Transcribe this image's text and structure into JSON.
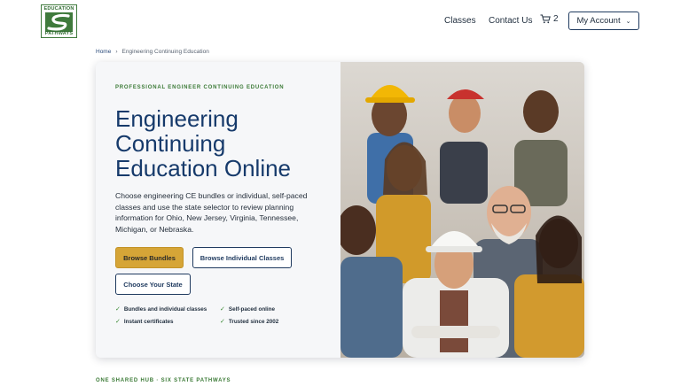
{
  "brand": {
    "logo_top": "EDUCATION",
    "logo_bottom": "PATHWAYS",
    "logo_color": "#3f7a3c"
  },
  "nav": {
    "classes": "Classes",
    "contact": "Contact Us",
    "cart_count": "2",
    "account": "My Account"
  },
  "breadcrumb": {
    "home": "Home",
    "separator": "›",
    "current": "Engineering Continuing Education"
  },
  "hero": {
    "eyebrow": "PROFESSIONAL ENGINEER CONTINUING EDUCATION",
    "title": "Engineering Continuing Education Online",
    "description": "Choose engineering CE bundles or individual, self-paced classes and use the state selector to review planning information for Ohio, New Jersey, Virginia, Tennessee, Michigan, or Nebraska.",
    "buttons": {
      "bundles": "Browse Bundles",
      "individual": "Browse Individual Classes",
      "state": "Choose Your State"
    },
    "features": [
      "Bundles and individual classes",
      "Self-paced online",
      "Instant certificates",
      "Trusted since 2002"
    ],
    "check_icon": "checkmark-icon"
  },
  "section": {
    "label": "ONE SHARED HUB · SIX STATE PATHWAYS"
  },
  "colors": {
    "accent_green": "#3b7a36",
    "title_blue": "#163a6b",
    "gold": "#d6a537",
    "navy": "#1f3a5f"
  }
}
